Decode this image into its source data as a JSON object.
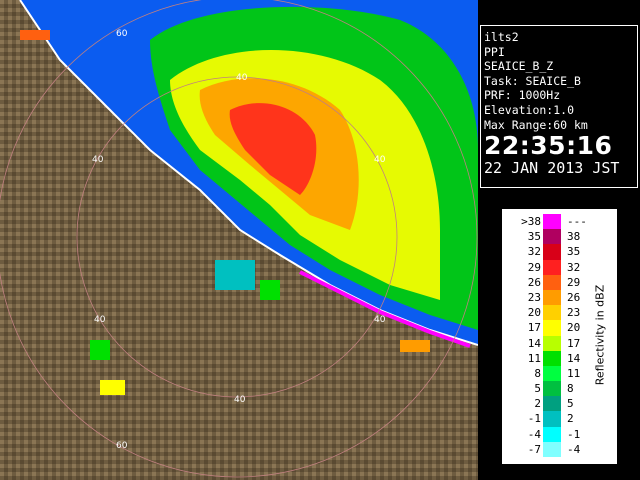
{
  "info": {
    "lines": [
      "ilts2",
      "PPI",
      "SEAICE_B_Z",
      "Task: SEAICE_B",
      "PRF: 1000Hz",
      "Elevation:1.0",
      "Max Range:60 km"
    ],
    "time": "22:35:16",
    "date": "22 JAN 2013 JST"
  },
  "legend": {
    "title": "Reflectivity in dBZ",
    "rows": [
      {
        "lo": ">38",
        "hi": "---",
        "color": "#ff00ff"
      },
      {
        "lo": "35",
        "hi": "38",
        "color": "#b00060"
      },
      {
        "lo": "32",
        "hi": "35",
        "color": "#d80018"
      },
      {
        "lo": "29",
        "hi": "32",
        "color": "#ff2020"
      },
      {
        "lo": "26",
        "hi": "29",
        "color": "#ff6010"
      },
      {
        "lo": "23",
        "hi": "26",
        "color": "#ff9c00"
      },
      {
        "lo": "20",
        "hi": "23",
        "color": "#ffd000"
      },
      {
        "lo": "17",
        "hi": "20",
        "color": "#ffff00"
      },
      {
        "lo": "14",
        "hi": "17",
        "color": "#b8ff00"
      },
      {
        "lo": "11",
        "hi": "14",
        "color": "#00e000"
      },
      {
        "lo": "8",
        "hi": "11",
        "color": "#00ff40"
      },
      {
        "lo": "5",
        "hi": "8",
        "color": "#00c040"
      },
      {
        "lo": "2",
        "hi": "5",
        "color": "#00a080"
      },
      {
        "lo": "-1",
        "hi": "2",
        "color": "#00c0c0"
      },
      {
        "lo": "-4",
        "hi": "-1",
        "color": "#00ffff"
      },
      {
        "lo": "-7",
        "hi": "-4",
        "color": "#80ffff"
      }
    ]
  },
  "map": {
    "range_labels": [
      "60",
      "40",
      "40",
      "40",
      "40",
      "60",
      "40",
      "40"
    ],
    "colors": {
      "sea": "#0b5cf0",
      "land": "#6b5a3e",
      "coast": "#ffffff",
      "ring": "#c08080"
    }
  }
}
